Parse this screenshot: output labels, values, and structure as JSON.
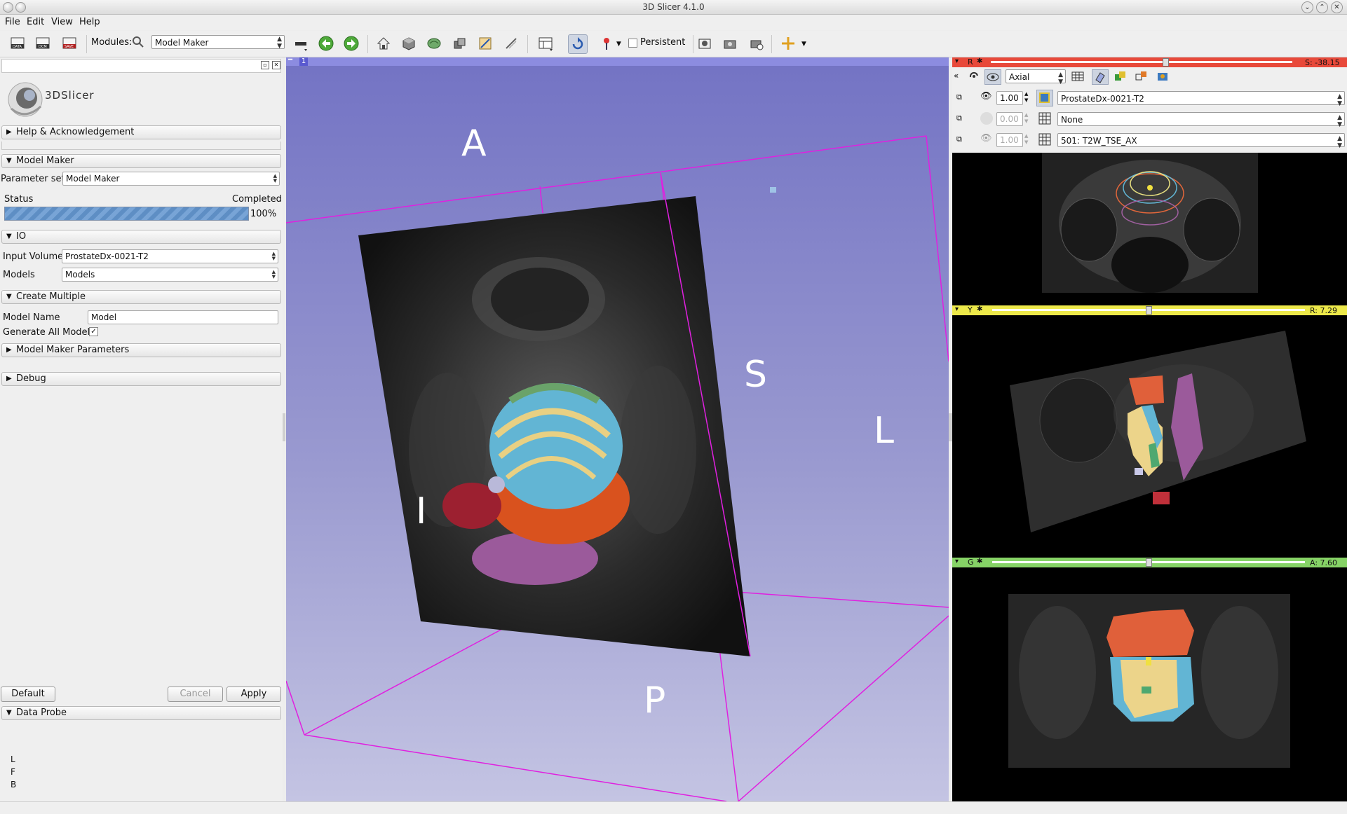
{
  "window": {
    "title": "3D Slicer 4.1.0"
  },
  "menu": {
    "file": "File",
    "edit": "Edit",
    "view": "View",
    "help": "Help"
  },
  "toolbar": {
    "modules_label": "Modules:",
    "module_selected": "Model Maker",
    "persistent_label": "Persistent",
    "icons": [
      "data-icon",
      "dcm-icon",
      "save-icon",
      "search-icon",
      "layout-icon",
      "back-icon",
      "forward-icon",
      "home-icon",
      "cube-icon",
      "brain-icon",
      "volumes-icon",
      "editor-icon",
      "transform-icon",
      "grid-layout-icon",
      "rotate-icon",
      "fiducial-icon",
      "screenshot-icon",
      "camera-icon",
      "scene-snapshot-icon",
      "crosshair-icon"
    ]
  },
  "logo": {
    "text": "3DSlicer"
  },
  "panel": {
    "help_section": "Help & Acknowledgement",
    "model_maker_section": "Model Maker",
    "parameter_set_label": "Parameter set:",
    "parameter_set_value": "Model Maker",
    "status_label": "Status",
    "status_value": "Completed",
    "progress_text": "100%",
    "progress_fraction": 1.0,
    "io_section": "IO",
    "input_volume_label": "Input Volume",
    "input_volume_value": "ProstateDx-0021-T2",
    "models_label": "Models",
    "models_value": "Models",
    "create_multiple_section": "Create Multiple",
    "model_name_label": "Model Name",
    "model_name_value": "Model",
    "generate_all_label": "Generate All Models",
    "generate_all_checked": true,
    "params_section": "Model Maker Parameters",
    "debug_section": "Debug",
    "default_button": "Default",
    "cancel_button": "Cancel",
    "apply_button": "Apply",
    "data_probe_section": "Data Probe",
    "probe_lines": [
      "L",
      "F",
      "B"
    ]
  },
  "view3d": {
    "tab_number": "1",
    "labels": {
      "a": "A",
      "s": "S",
      "l": "L",
      "i": "I",
      "p": "P"
    }
  },
  "slices": {
    "red": {
      "letter": "R",
      "readout": "S: -38.15",
      "slider_fraction": 0.58,
      "orientation": "Axial",
      "fg_opacity": "1.00",
      "fg_volume": "ProstateDx-0021-T2",
      "bg_opacity": "0.00",
      "bg_volume": "None",
      "label_opacity": "1.00",
      "label_volume": "501: T2W_TSE_AX"
    },
    "yellow": {
      "letter": "Y",
      "readout": "R: 7.29",
      "slider_fraction": 0.5
    },
    "green": {
      "letter": "G",
      "readout": "A: 7.60",
      "slider_fraction": 0.5
    }
  },
  "colors": {
    "red_bar": "#e8493a",
    "yellow_bar": "#ede94a",
    "green_bar": "#86d366",
    "view_bg_top": "#7373c4",
    "view_bg_bottom": "#c4c4e3",
    "bbox": "#e020e0"
  }
}
